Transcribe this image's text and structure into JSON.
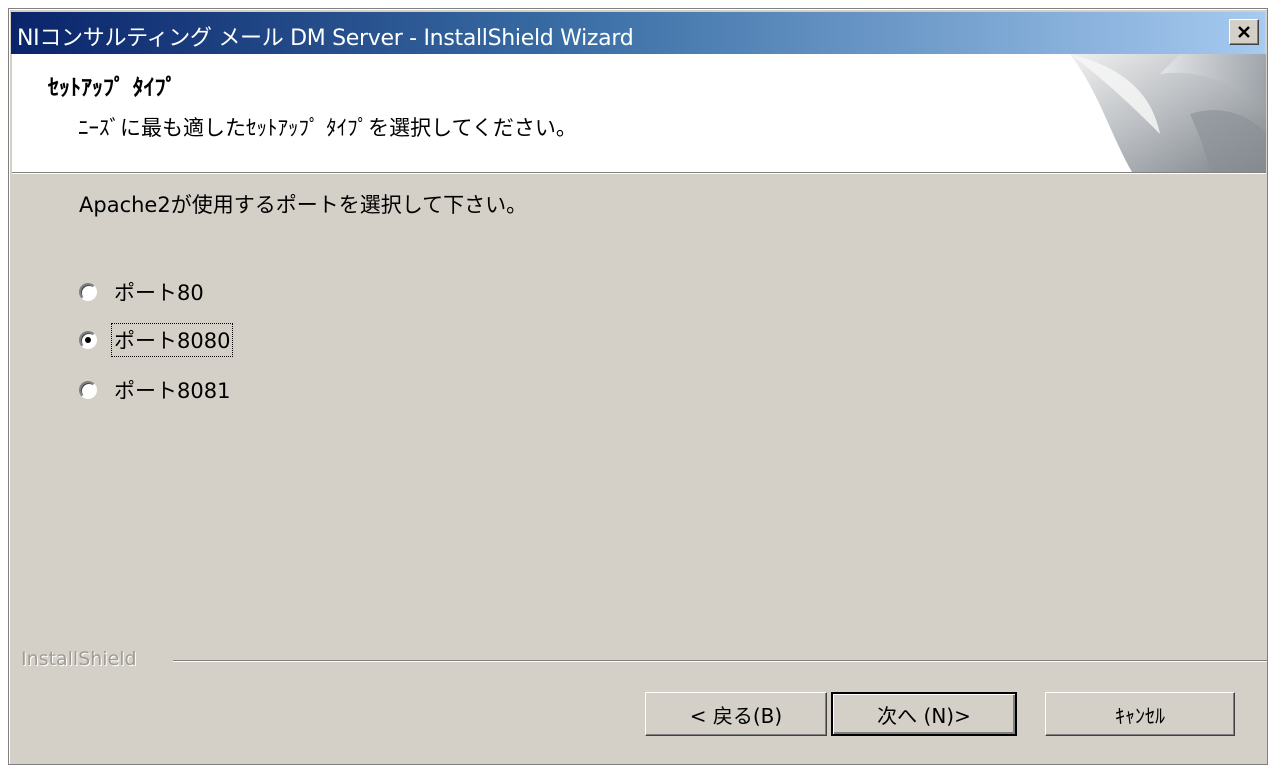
{
  "window": {
    "title": "NIコンサルティング メール DM Server - InstallShield Wizard",
    "close_label": "×"
  },
  "header": {
    "title": "ｾｯﾄｱｯﾌﾟ ﾀｲﾌﾟ",
    "subtitle": "ﾆｰｽﾞに最も適したｾｯﾄｱｯﾌﾟ ﾀｲﾌﾟを選択してください。"
  },
  "main": {
    "prompt": "Apache2が使用するポートを選択して下さい。",
    "options": [
      {
        "label": "ポート80",
        "selected": false
      },
      {
        "label": "ポート8080",
        "selected": true
      },
      {
        "label": "ポート8081",
        "selected": false
      }
    ]
  },
  "footer": {
    "brand": "InstallShield",
    "buttons": {
      "back": "< 戻る(B)",
      "next": "次へ (N)>",
      "cancel": "ｷｬﾝｾﾙ"
    }
  },
  "colors": {
    "title_bar_start": "#0a246a",
    "title_bar_end": "#a6caf0",
    "dialog_face": "#d4d0c8"
  }
}
